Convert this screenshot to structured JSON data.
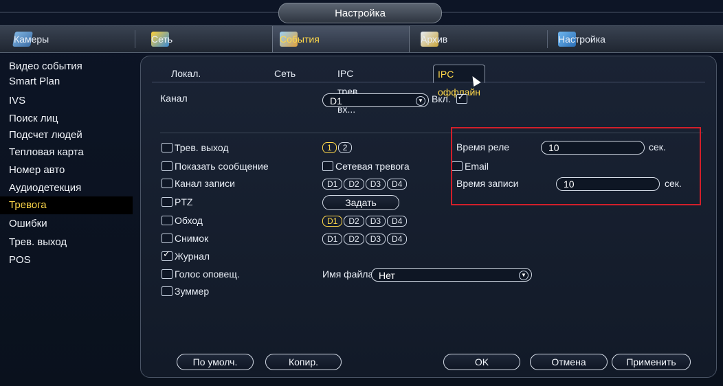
{
  "window": {
    "title": "Настройка"
  },
  "topnav": {
    "tabs": [
      {
        "label": "Камеры",
        "icon": "camera-icon"
      },
      {
        "label": "Сеть",
        "icon": "network-icon"
      },
      {
        "label": "События",
        "icon": "events-icon",
        "active": true
      },
      {
        "label": "Архив",
        "icon": "archive-icon"
      },
      {
        "label": "Настройка",
        "icon": "settings-icon"
      }
    ]
  },
  "sidebar": {
    "items": [
      {
        "label": "Видео события"
      },
      {
        "label": "Smart Plan"
      },
      {
        "label": "IVS"
      },
      {
        "label": "Поиск лиц"
      },
      {
        "label": "Подсчет людей"
      },
      {
        "label": "Тепловая карта"
      },
      {
        "label": "Номер авто"
      },
      {
        "label": "Аудиодетекция"
      },
      {
        "label": "Тревога",
        "active": true
      },
      {
        "label": "Ошибки"
      },
      {
        "label": "Трев. выход"
      },
      {
        "label": "POS"
      }
    ]
  },
  "subtabs": [
    {
      "label": "Локал."
    },
    {
      "label": "Сеть"
    },
    {
      "label": "IPC трев. вх..."
    },
    {
      "label": "IPC оффлайн",
      "active": true
    }
  ],
  "form": {
    "channel_label": "Канал",
    "channel_value": "D1",
    "enable_label": "Вкл.",
    "enable_checked": true,
    "alarm_out_label": "Трев. выход",
    "alarm_out_chips": [
      "1",
      "2"
    ],
    "relay_time_label": "Время реле",
    "relay_time_value": "10",
    "relay_time_unit": "сек.",
    "show_message_label": "Показать сообщение",
    "network_alarm_label": "Сетевая тревога",
    "email_label": "Email",
    "record_channel_label": "Канал записи",
    "record_chips": [
      "D1",
      "D2",
      "D3",
      "D4"
    ],
    "record_time_label": "Время записи",
    "record_time_value": "10",
    "record_time_unit": "сек.",
    "ptz_label": "PTZ",
    "ptz_button": "Задать",
    "tour_label": "Обход",
    "tour_chips": [
      "D1",
      "D2",
      "D3",
      "D4"
    ],
    "snapshot_label": "Снимок",
    "snapshot_chips": [
      "D1",
      "D2",
      "D3",
      "D4"
    ],
    "log_label": "Журнал",
    "log_checked": true,
    "voice_label": "Голос оповещ.",
    "filename_label": "Имя файла",
    "filename_value": "Нет",
    "buzzer_label": "Зуммер"
  },
  "buttons": {
    "default": "По умолч.",
    "copy": "Копир.",
    "ok": "OK",
    "cancel": "Отмена",
    "apply": "Применить"
  },
  "colors": {
    "accent": "#ffd84a",
    "highlight_box": "#d21f2a"
  }
}
